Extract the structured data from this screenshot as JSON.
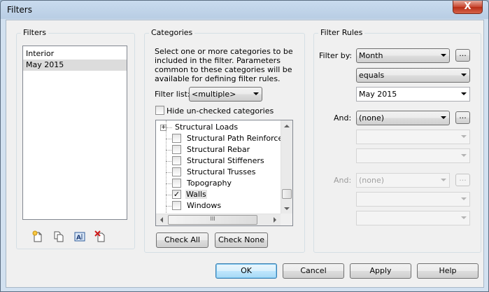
{
  "window": {
    "title": "Filters",
    "close_label": "X"
  },
  "filters_panel": {
    "title": "Filters",
    "items": [
      {
        "label": "Interior",
        "selected": false
      },
      {
        "label": "May 2015",
        "selected": true
      }
    ],
    "toolbar_icons": [
      "new-filter-icon",
      "duplicate-filter-icon",
      "rename-filter-icon",
      "delete-filter-icon"
    ]
  },
  "categories_panel": {
    "title": "Categories",
    "description": "Select one or more categories to be included in the filter.  Parameters common to these categories will be available for defining filter rules.",
    "filter_list_label": "Filter list:",
    "filter_list_value": "<multiple>",
    "hide_unchecked_label": "Hide un-checked categories",
    "hide_unchecked_checked": false,
    "tree": [
      {
        "label": "Structural Loads",
        "type": "group",
        "checked": false
      },
      {
        "label": "Structural Path Reinforcem...",
        "type": "item",
        "checked": false
      },
      {
        "label": "Structural Rebar",
        "type": "item",
        "checked": false
      },
      {
        "label": "Structural Stiffeners",
        "type": "item",
        "checked": false
      },
      {
        "label": "Structural Trusses",
        "type": "item",
        "checked": false
      },
      {
        "label": "Topography",
        "type": "item",
        "checked": false
      },
      {
        "label": "Walls",
        "type": "item",
        "checked": true
      },
      {
        "label": "Windows",
        "type": "item",
        "checked": false
      }
    ],
    "scroll_grip": "III",
    "check_all_label": "Check All",
    "check_none_label": "Check None"
  },
  "filter_rules_panel": {
    "title": "Filter Rules",
    "filter_by_label": "Filter by:",
    "filter_by_value": "Month",
    "operator_value": "equals",
    "value_value": "May 2015",
    "and1_label": "And:",
    "and1_value": "(none)",
    "and2_label": "And:",
    "and2_value": "(none)",
    "ellipsis_label": "..."
  },
  "buttons": {
    "ok": "OK",
    "cancel": "Cancel",
    "apply": "Apply",
    "help": "Help"
  }
}
